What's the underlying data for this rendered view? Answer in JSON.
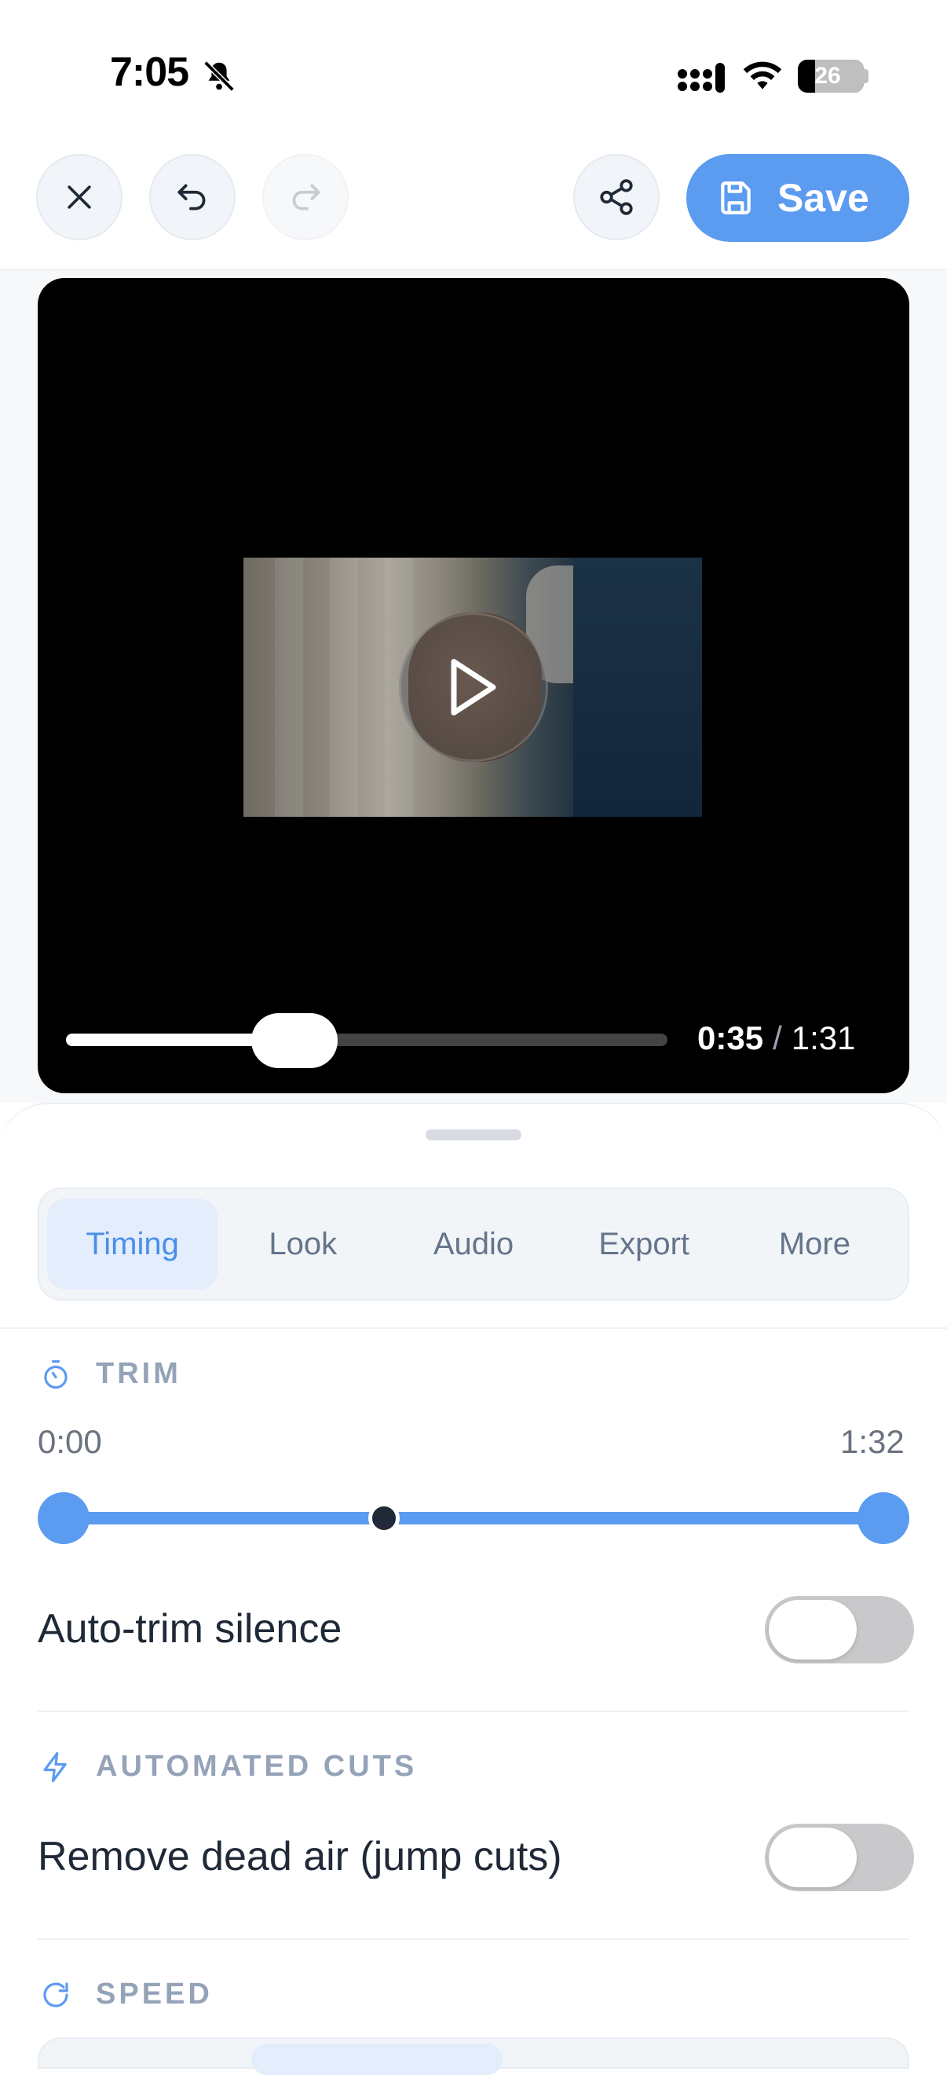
{
  "status_bar": {
    "time": "7:05",
    "battery": "26",
    "icons": [
      "bell-slash-icon",
      "signal-icon",
      "wifi-icon",
      "battery-icon"
    ]
  },
  "toolbar": {
    "close_icon": "close-icon",
    "undo_icon": "undo-icon",
    "redo_icon": "redo-icon",
    "share_icon": "share-icon",
    "save_label": "Save",
    "save_icon": "save-disk-icon"
  },
  "player": {
    "current_time": "0:35",
    "separator": "/",
    "duration": "1:31",
    "progress": 0.38
  },
  "tabs": [
    {
      "label": "Timing",
      "active": true
    },
    {
      "label": "Look",
      "active": false
    },
    {
      "label": "Audio",
      "active": false
    },
    {
      "label": "Export",
      "active": false
    },
    {
      "label": "More",
      "active": false
    }
  ],
  "trim": {
    "heading": "TRIM",
    "start": "0:00",
    "end": "1:32",
    "auto_trim_label": "Auto-trim silence",
    "auto_trim_on": false
  },
  "automated_cuts": {
    "heading": "AUTOMATED CUTS",
    "remove_dead_air_label": "Remove dead air (jump cuts)",
    "remove_dead_air_on": false
  },
  "speed": {
    "heading": "SPEED"
  },
  "colors": {
    "accent": "#5b9bf0",
    "tab_active_bg": "#e3edfb",
    "toggle_off": "#c9c9cb"
  }
}
